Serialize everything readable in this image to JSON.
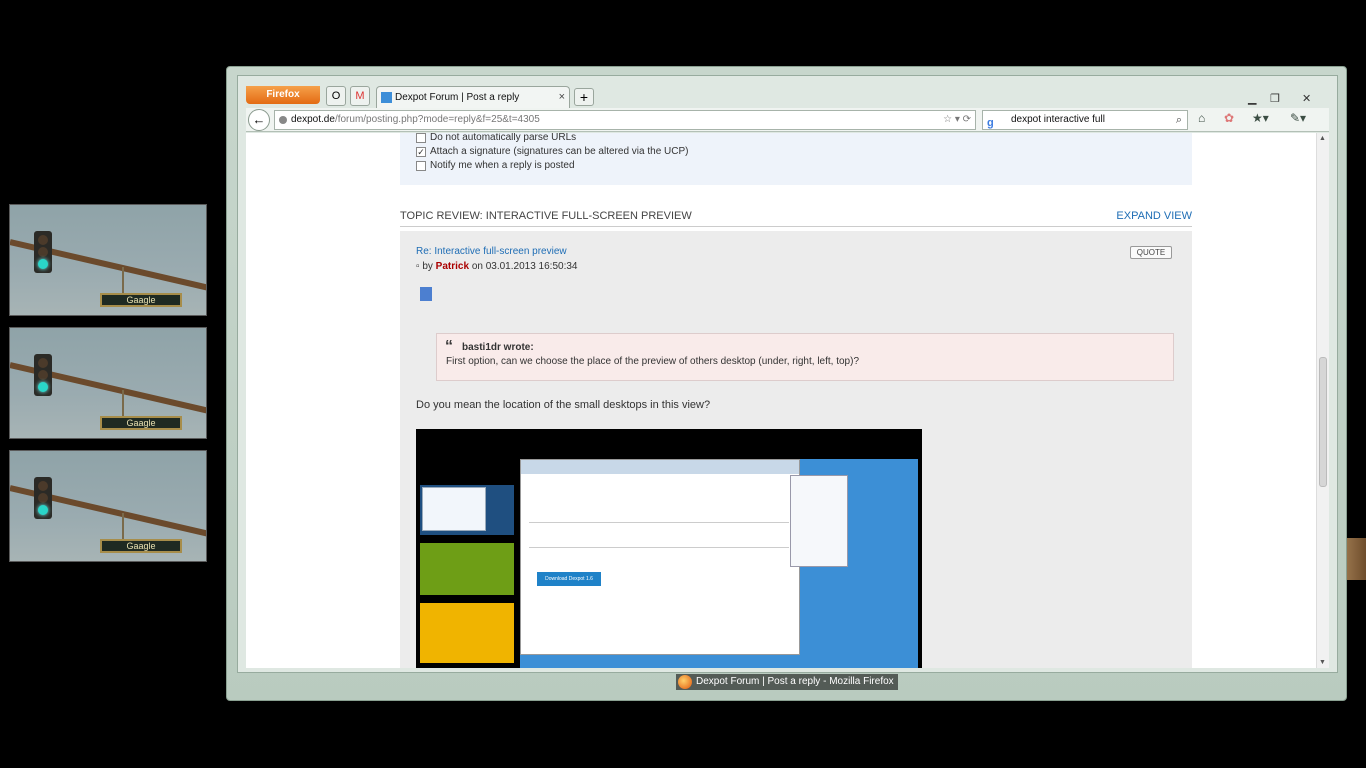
{
  "desktop_previews": [
    {
      "sign_text": "Gaagle"
    },
    {
      "sign_text": "Gaagle"
    },
    {
      "sign_text": "Gaagle"
    }
  ],
  "browser": {
    "menu_button": "Firefox",
    "tab_title": "Dexpot Forum | Post a reply",
    "tab_close": "×",
    "new_tab": "+",
    "url_host": "dexpot.de",
    "url_path": "/forum/posting.php?mode=reply&f=25&t=4305",
    "search_value": "dexpot interactive full",
    "window_title": "Dexpot Forum | Post a reply - Mozilla Firefox"
  },
  "options": [
    {
      "label": "Do not automatically parse URLs",
      "checked": false
    },
    {
      "label": "Attach a signature (signatures can be altered via the UCP)",
      "checked": true
    },
    {
      "label": "Notify me when a reply is posted",
      "checked": false
    }
  ],
  "topic_review": {
    "heading": "TOPIC REVIEW: INTERACTIVE FULL-SCREEN PREVIEW",
    "expand": "EXPAND VIEW"
  },
  "post": {
    "title": "Re: Interactive full-screen preview",
    "by": "by",
    "author": "Patrick",
    "date": "on 03.01.2013 16:50:34",
    "quote_button": "QUOTE",
    "quote_author": "basti1dr wrote:",
    "quote_text": "First option, can we choose the place of the preview of others desktop (under, right, left, top)?",
    "body": "Do you mean the location of the small desktops in this view?"
  },
  "screenshot_image": {
    "download_label": "Download Dexpot 1.6"
  }
}
